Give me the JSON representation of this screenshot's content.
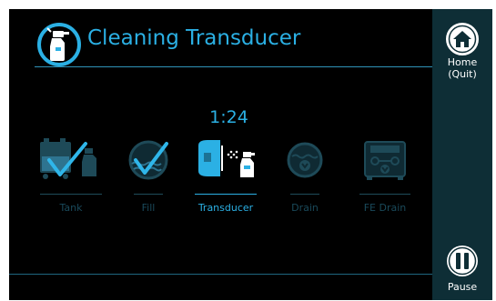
{
  "header": {
    "title": "Cleaning Transducer",
    "title_icon": "spray-bottle-icon"
  },
  "timer": "1:24",
  "steps": [
    {
      "label": "Tank",
      "state": "done",
      "icon": "tank-icon"
    },
    {
      "label": "Fill",
      "state": "done",
      "icon": "fill-icon"
    },
    {
      "label": "Transducer",
      "state": "active",
      "icon": "transducer-icon"
    },
    {
      "label": "Drain",
      "state": "pending",
      "icon": "drain-icon"
    },
    {
      "label": "FE Drain",
      "state": "pending",
      "icon": "fe-drain-icon"
    }
  ],
  "sidebar": {
    "home": {
      "line1": "Home",
      "line2": "(Quit)",
      "icon": "home-icon"
    },
    "pause": {
      "label": "Pause",
      "icon": "pause-icon"
    }
  },
  "colors": {
    "accent": "#2bb0e4",
    "check": "#2fb6ea",
    "inactive": "#1a4a5b",
    "sidebar": "#0e2e36",
    "background": "#000000"
  }
}
